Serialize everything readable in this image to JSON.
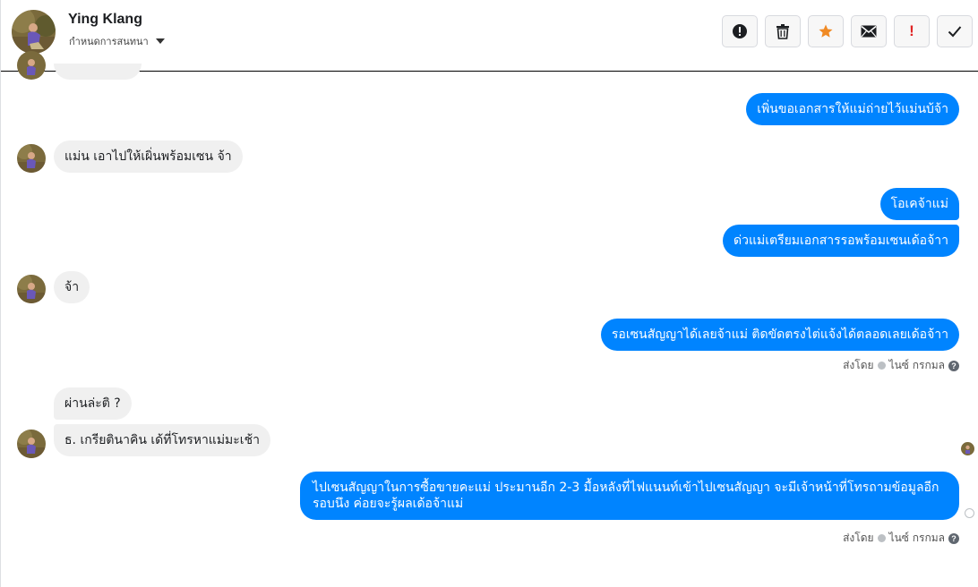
{
  "header": {
    "name": "Ying Klang",
    "subtitle": "กำหนดการสนทนา",
    "avatar_icon": "profile-photo",
    "tools": [
      {
        "name": "report-icon",
        "label": "!"
      },
      {
        "name": "trash-icon",
        "label": ""
      },
      {
        "name": "star-icon",
        "label": ""
      },
      {
        "name": "mail-icon",
        "label": ""
      },
      {
        "name": "exclamation-icon",
        "label": "!"
      },
      {
        "name": "checkmark-icon",
        "label": ""
      }
    ]
  },
  "colors": {
    "outgoing": "#0084ff",
    "incoming": "#f0f0f0",
    "star": "#f08a24",
    "alert": "#e02424"
  },
  "messages": [
    {
      "dir": "out",
      "text": "เพิ่นขอเอกสารให้แม่ถ่ายไว้แม่นบ้จ้า"
    },
    {
      "dir": "in",
      "text": "แม่น เอาไปให้เผิ่นพร้อมเซน จ้า"
    },
    {
      "dir": "out",
      "text": "โอเคจ้าแม่"
    },
    {
      "dir": "out",
      "text": "ด่วแม่เตรียมเอกสารรอพร้อมเซนเด้อจ้าา"
    },
    {
      "dir": "in",
      "text": "จ้า"
    },
    {
      "dir": "out",
      "text": "รอเซนสัญญาได้เลยจ้าแม่ ติดขัดตรงไต่แจ้งได้ตลอดเลยเด้อจ้าา"
    },
    {
      "dir": "in",
      "text": "ผ่านล่ะติ ?"
    },
    {
      "dir": "in",
      "text": "ธ. เกรียตินาคิน เด้ที่โทรหาแม่มะเช้า"
    },
    {
      "dir": "out",
      "text": "ไปเซนสัญญาในการซื้อขายคะแม่ ประมานอีก 2-3 มื้อหลังที่ไฟแนนท์เข้าไปเซนสัญญา  จะมีเจ้าหน้าที่โทรถามข้อมูลอีกรอบนึง ค่อยจะรู้ผลเด้อจ้าแม่"
    }
  ],
  "sent_meta": [
    {
      "prefix": "ส่งโดย",
      "sender": "ไนซ์ กรกมล",
      "help": "?"
    },
    {
      "prefix": "ส่งโดย",
      "sender": "ไนซ์ กรกมล",
      "help": "?"
    }
  ]
}
